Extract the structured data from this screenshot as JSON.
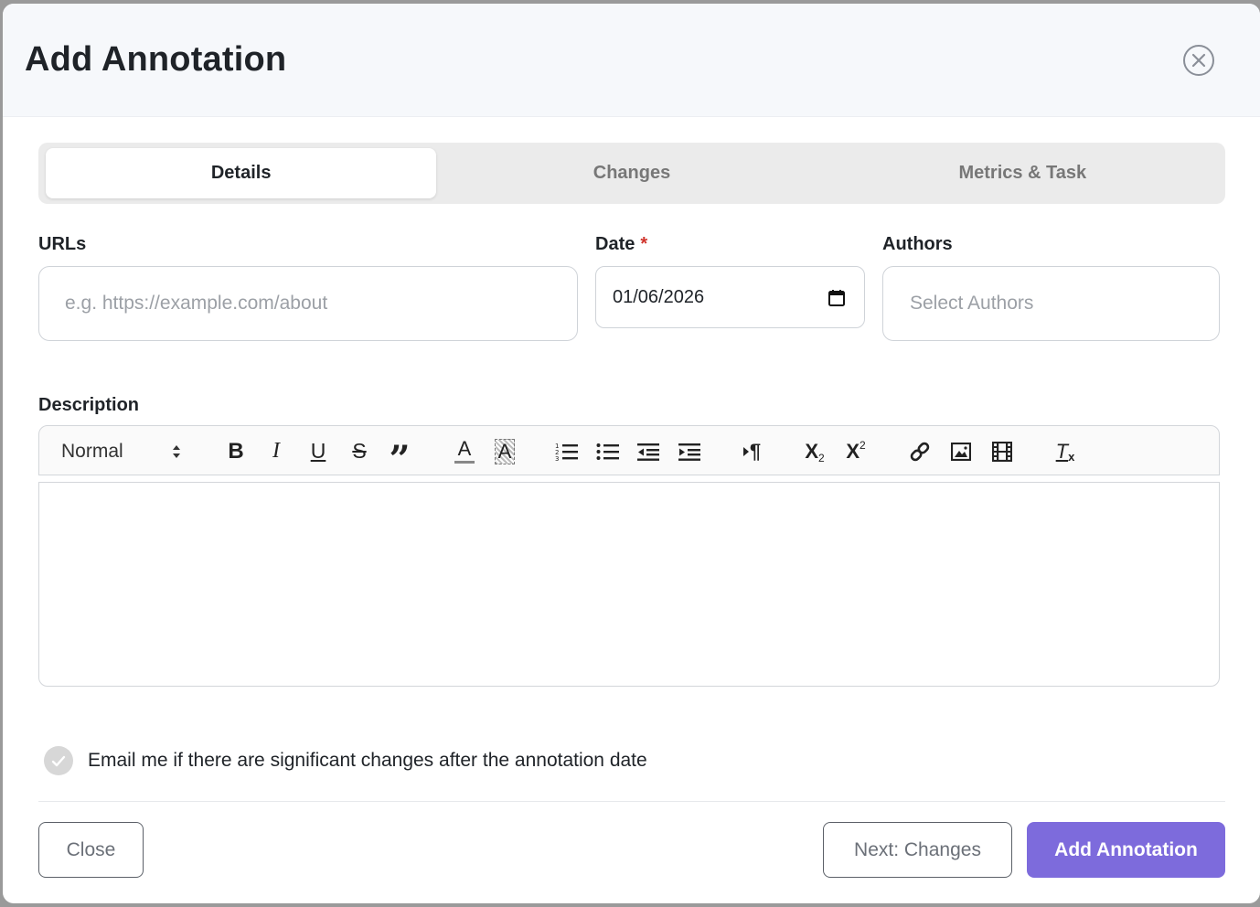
{
  "modal": {
    "title": "Add Annotation"
  },
  "tabs": [
    {
      "label": "Details",
      "active": true
    },
    {
      "label": "Changes",
      "active": false
    },
    {
      "label": "Metrics & Task",
      "active": false
    }
  ],
  "fields": {
    "urls": {
      "label": "URLs",
      "placeholder": "e.g. https://example.com/about"
    },
    "date": {
      "label": "Date",
      "required_marker": "*",
      "value": "01/06/2026"
    },
    "authors": {
      "label": "Authors",
      "placeholder": "Select Authors"
    },
    "description": {
      "label": "Description"
    }
  },
  "toolbar": {
    "heading_select": "Normal",
    "bold": "B",
    "italic": "I",
    "underline": "U",
    "strike": "S",
    "quote": "”",
    "font_color": "A",
    "bg_color": "A",
    "paragraph": "¶",
    "subscript_base": "X",
    "subscript_mark": "2",
    "superscript_base": "X",
    "superscript_mark": "2",
    "clear_base": "T",
    "clear_mark": "x"
  },
  "email_option": {
    "label": "Email me if there are significant changes after the annotation date",
    "checked": true
  },
  "footer": {
    "close_label": "Close",
    "next_label": "Next: Changes",
    "submit_label": "Add Annotation"
  },
  "colors": {
    "primary": "#7d6bdc",
    "required": "#d0342c",
    "header_bg": "#f6f8fb"
  }
}
